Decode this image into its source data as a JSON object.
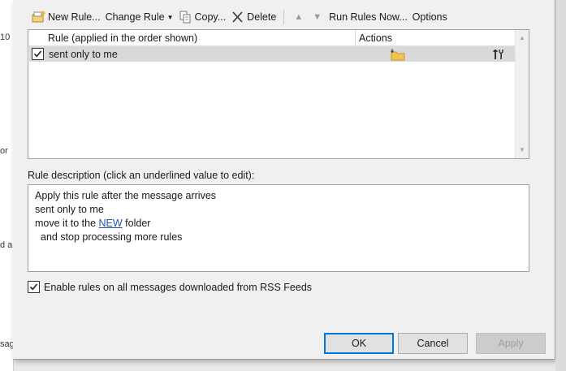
{
  "background": {
    "fragments": [
      "10",
      "or",
      "d a",
      "sag"
    ]
  },
  "toolbar": {
    "new_rule": "New Rule...",
    "change_rule": "Change Rule",
    "copy": "Copy...",
    "delete": "Delete",
    "run_rules_now": "Run Rules Now...",
    "options": "Options"
  },
  "rules_list": {
    "col_rule": "Rule (applied in the order shown)",
    "col_actions": "Actions",
    "rows": [
      {
        "name": "sent only to me",
        "enabled": true,
        "icons": [
          "move-to-folder-icon",
          "rule-settings-icon"
        ]
      }
    ]
  },
  "description": {
    "label": "Rule description (click an underlined value to edit):",
    "line1": "Apply this rule after the message arrives",
    "line2": "sent only to me",
    "line3_prefix": "move it to the ",
    "line3_link": "NEW",
    "line3_suffix": " folder",
    "line4": "and stop processing more rules"
  },
  "rss": {
    "label": "Enable rules on all messages downloaded from RSS Feeds",
    "checked": true
  },
  "buttons": {
    "ok": "OK",
    "cancel": "Cancel",
    "apply": "Apply"
  },
  "colors": {
    "accent": "#0078d7",
    "link": "#1f56b5",
    "selected_row": "#d9d9d9"
  }
}
